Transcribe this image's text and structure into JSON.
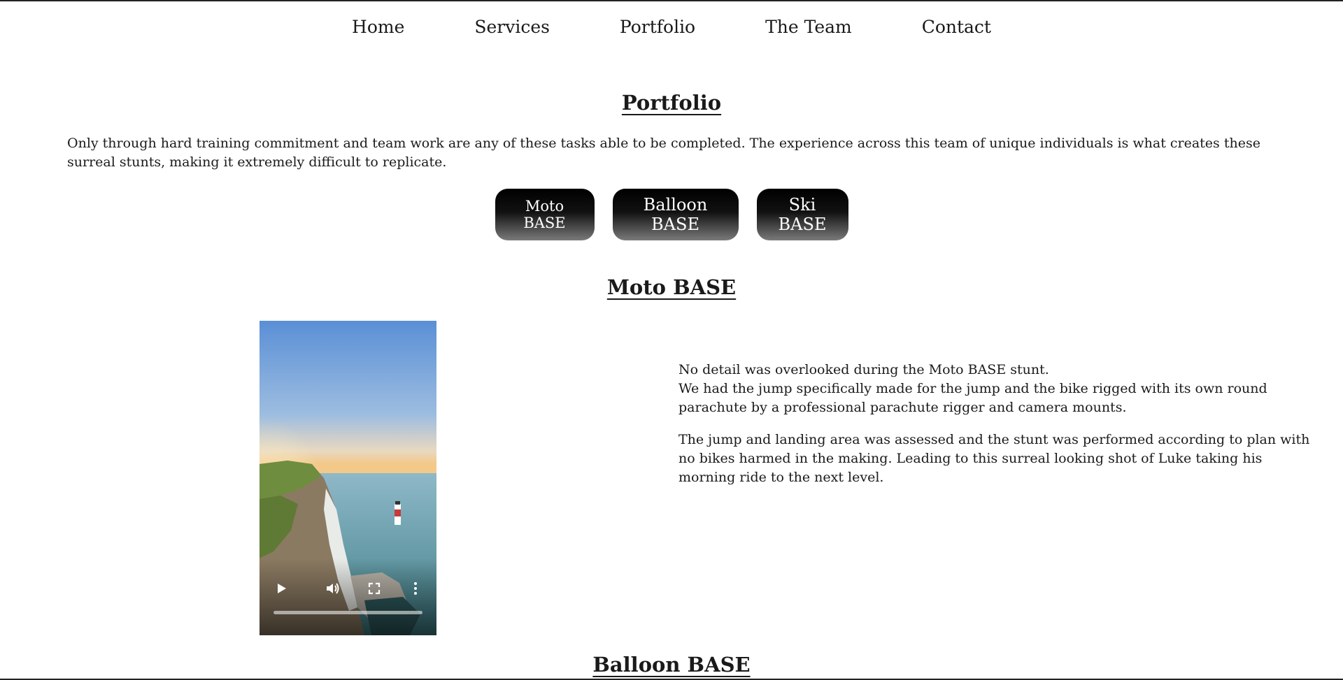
{
  "nav": {
    "items": [
      "Home",
      "Services",
      "Portfolio",
      "The Team",
      "Contact"
    ]
  },
  "portfolio": {
    "title": "Portfolio",
    "intro": "Only through hard training commitment and team work are any of these tasks able to be completed. The experience across this team of unique individuals is what creates these surreal stunts, making it extremely difficult to replicate.",
    "buttons": [
      "Moto BASE",
      "Balloon BASE",
      "Ski BASE"
    ]
  },
  "moto": {
    "title": "Moto BASE",
    "line1": "No detail was overlooked during the Moto BASE stunt.",
    "line2": "We had the jump specifically made for the jump and the bike rigged with its own round parachute by a professional parachute rigger and camera mounts.",
    "para2": "The jump and landing area was assessed and the stunt was performed according to plan with no bikes harmed in the making. Leading to this surreal looking shot of Luke taking his morning ride to the next level.",
    "video": {
      "progress": 0,
      "icons": [
        "play-icon",
        "volume-icon",
        "fullscreen-icon",
        "more-options-icon"
      ]
    }
  },
  "balloon": {
    "title": "Balloon BASE"
  }
}
